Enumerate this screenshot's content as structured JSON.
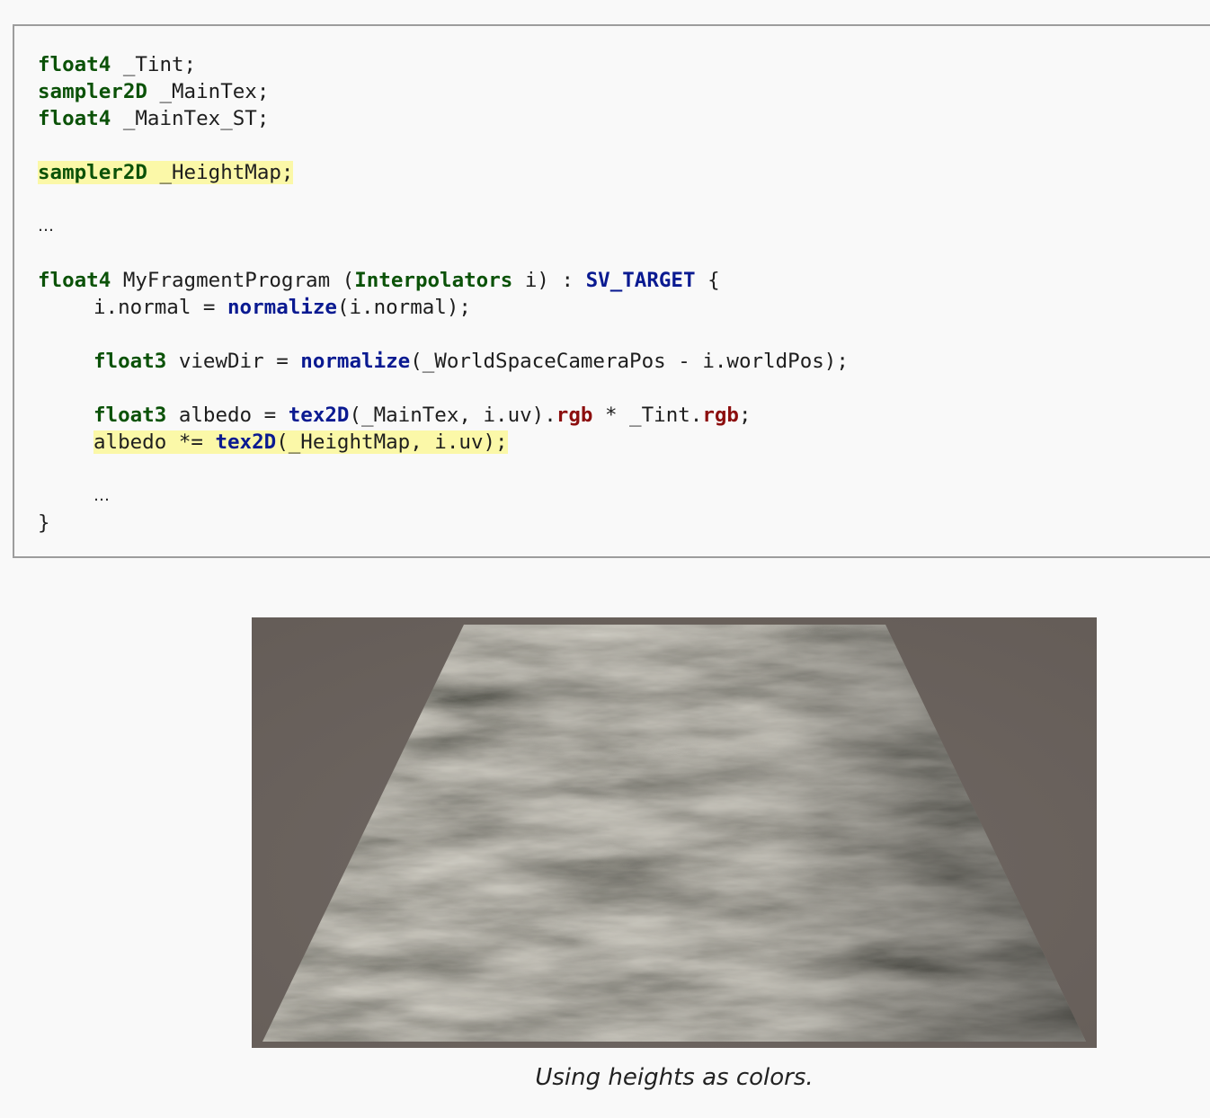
{
  "code": {
    "l1": {
      "type": "float4",
      "name": " _Tint;"
    },
    "l2": {
      "type": "sampler2D",
      "name": " _MainTex;"
    },
    "l3": {
      "type": "float4",
      "name": " _MainTex_ST;"
    },
    "l4": {
      "type": "sampler2D",
      "name": " _HeightMap;"
    },
    "l5": {
      "ellipsis": "…"
    },
    "l6": {
      "type": "float4",
      "func": " MyFragmentProgram (",
      "param_type": "Interpolators",
      "param": " i) : ",
      "semantic": "SV_TARGET",
      "brace": " {"
    },
    "l7": {
      "lhs": "i.normal = ",
      "fn": "normalize",
      "rest": "(i.normal);"
    },
    "l8": {
      "type": "float3",
      "lhs": " viewDir = ",
      "fn": "normalize",
      "rest": "(_WorldSpaceCameraPos - i.worldPos);"
    },
    "l9": {
      "type": "float3",
      "lhs": " albedo = ",
      "fn": "tex2D",
      "args": "(_MainTex, i.uv).",
      "swz1": "rgb",
      "mid": " * _Tint.",
      "swz2": "rgb",
      "end": ";"
    },
    "l10": {
      "lhs": "albedo *= ",
      "fn": "tex2D",
      "rest": "(_HeightMap, i.uv);"
    },
    "l11": {
      "ellipsis": "…"
    },
    "l12": {
      "brace": "}"
    }
  },
  "figure": {
    "caption": "Using heights as colors."
  }
}
